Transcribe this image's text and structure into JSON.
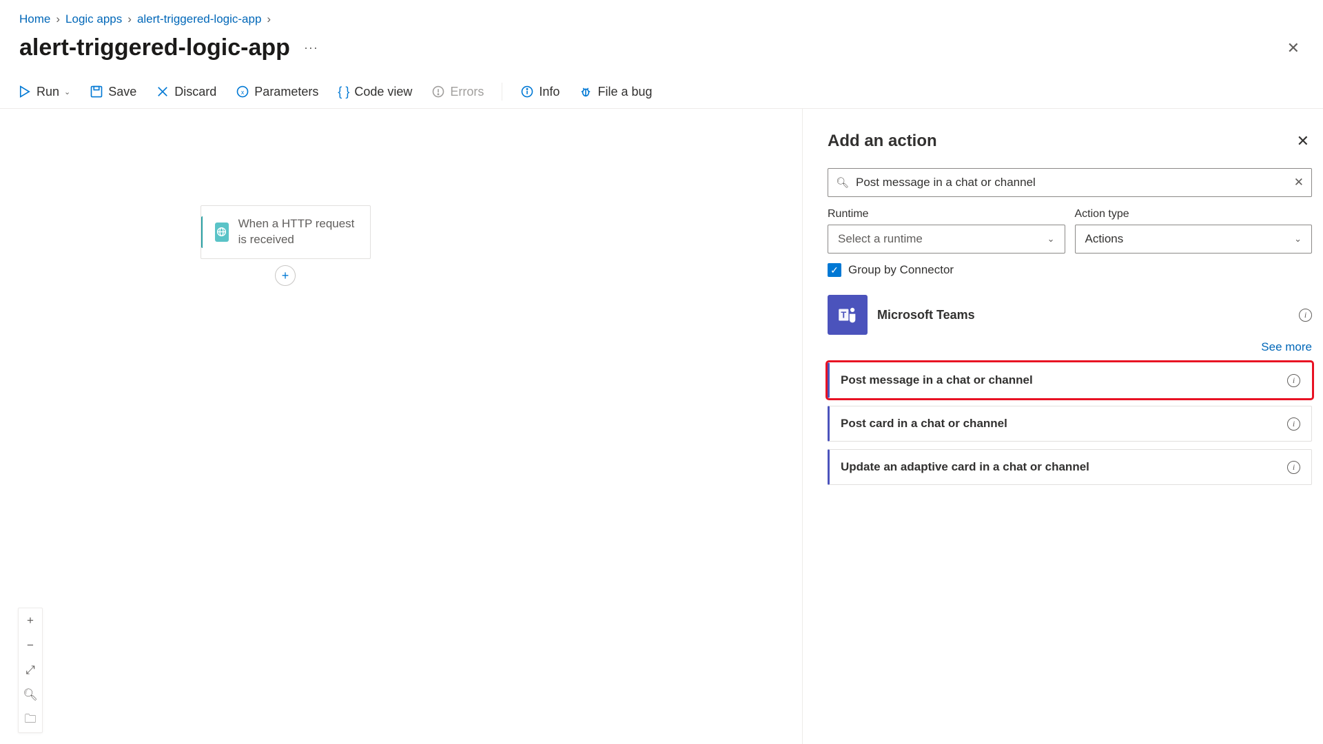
{
  "breadcrumbs": [
    "Home",
    "Logic apps",
    "alert-triggered-logic-app"
  ],
  "page_title": "alert-triggered-logic-app",
  "toolbar": {
    "run": "Run",
    "save": "Save",
    "discard": "Discard",
    "parameters": "Parameters",
    "codeview": "Code view",
    "errors": "Errors",
    "info": "Info",
    "bug": "File a bug"
  },
  "trigger": {
    "label": "When a HTTP request is received"
  },
  "panel": {
    "title": "Add an action",
    "search_value": "Post message in a chat or channel",
    "runtime_label": "Runtime",
    "runtime_placeholder": "Select a runtime",
    "actiontype_label": "Action type",
    "actiontype_value": "Actions",
    "group_label": "Group by Connector",
    "group_checked": true,
    "connector": {
      "name": "Microsoft Teams",
      "see_more": "See more"
    },
    "actions": [
      {
        "name": "Post message in a chat or channel",
        "highlight": true
      },
      {
        "name": "Post card in a chat or channel",
        "highlight": false
      },
      {
        "name": "Update an adaptive card in a chat or channel",
        "highlight": false
      }
    ]
  }
}
